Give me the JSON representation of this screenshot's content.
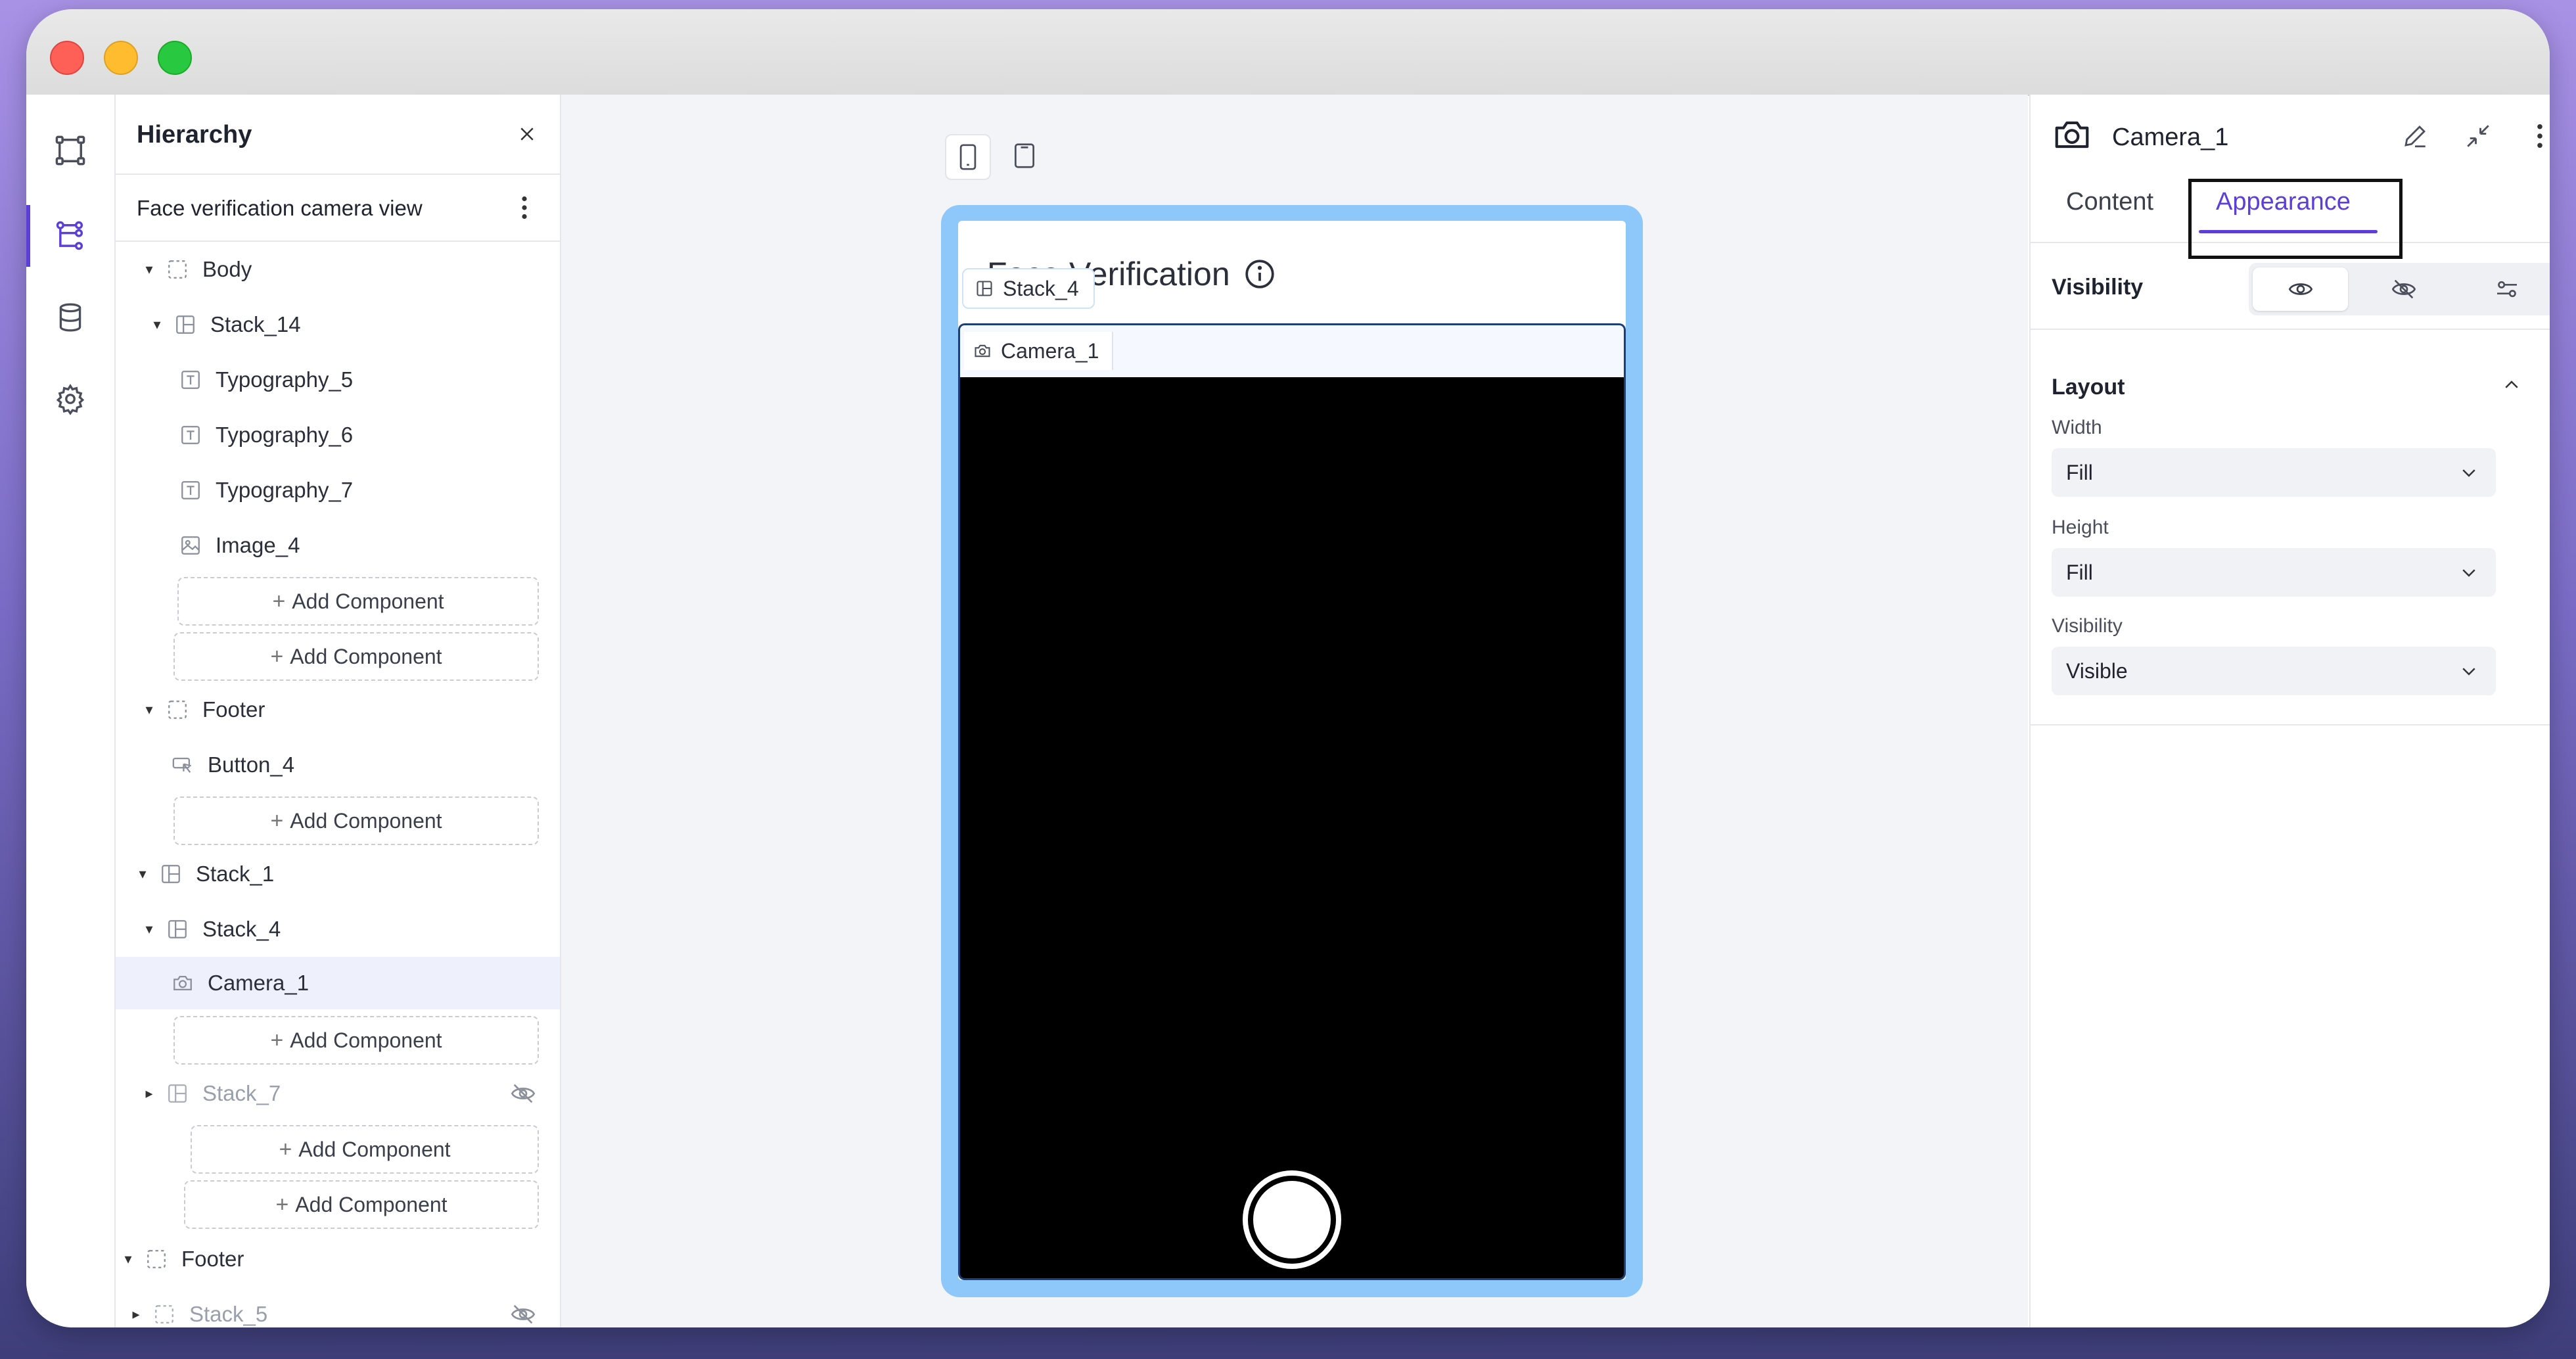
{
  "hierarchy": {
    "title": "Hierarchy",
    "screen_name": "Face verification camera view",
    "add_component_label": "Add Component",
    "nodes": {
      "body": "Body",
      "stack14": "Stack_14",
      "typo5": "Typography_5",
      "typo6": "Typography_6",
      "typo7": "Typography_7",
      "image4": "Image_4",
      "footer1": "Footer",
      "button4": "Button_4",
      "stack1": "Stack_1",
      "stack4": "Stack_4",
      "camera1": "Camera_1",
      "stack7": "Stack_7",
      "footer2": "Footer",
      "stack5": "Stack_5"
    }
  },
  "canvas": {
    "heading": "Face Verification",
    "stack_chip": "Stack_4",
    "camera_chip": "Camera_1"
  },
  "properties": {
    "component_name": "Camera_1",
    "tabs": {
      "content": "Content",
      "appearance": "Appearance"
    },
    "visibility_label": "Visibility",
    "layout": {
      "title": "Layout",
      "width_label": "Width",
      "width_value": "Fill",
      "height_label": "Height",
      "height_value": "Fill",
      "visibility_label": "Visibility",
      "visibility_value": "Visible"
    }
  },
  "colors": {
    "accent": "#5b3fd8",
    "device_frame": "#8ec8fb",
    "selection_border": "#1c3f7a"
  }
}
